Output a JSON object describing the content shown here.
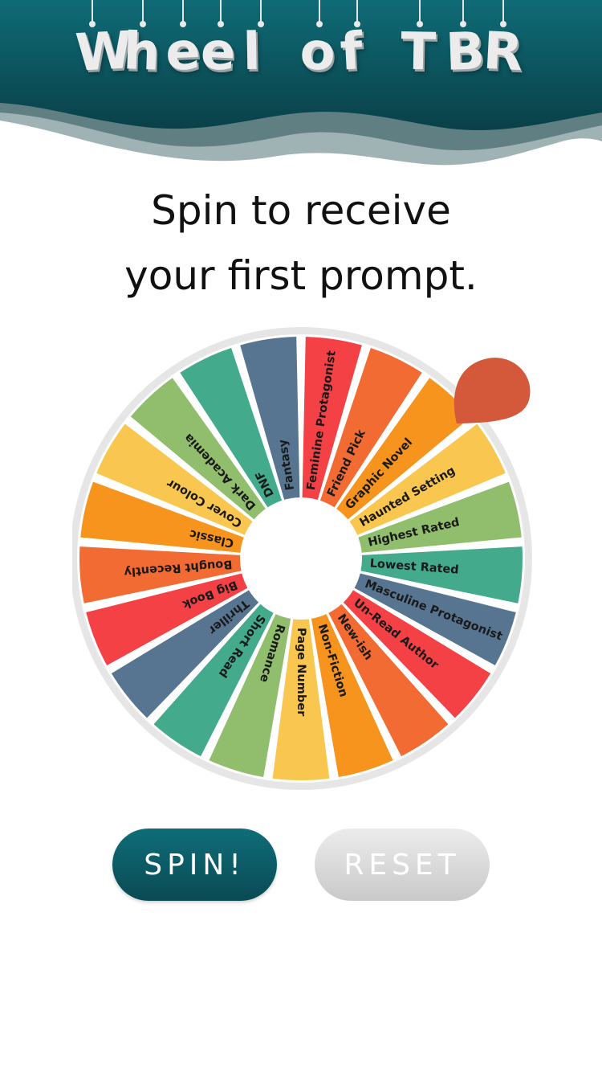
{
  "header": {
    "title": "Wheel of TBR",
    "colors": {
      "teal_top": "#0e6b76",
      "teal_bottom": "#0a4048",
      "wave_light": "#8ea3a6"
    }
  },
  "prompt": {
    "line1": "Spin to receive",
    "line2": "your first prompt."
  },
  "wheel": {
    "rim_color": "#e6e6e6",
    "pointer_color": "#d4583a",
    "segments": [
      {
        "label": "Feminine Protagonist",
        "color": "#f44146"
      },
      {
        "label": "Friend Pick",
        "color": "#f26b33"
      },
      {
        "label": "Graphic Novel",
        "color": "#f7941d"
      },
      {
        "label": "Haunted Setting",
        "color": "#f9c74f"
      },
      {
        "label": "Highest Rated",
        "color": "#90be6d"
      },
      {
        "label": "Lowest Rated",
        "color": "#43aa8b"
      },
      {
        "label": "Masculine Protagonist",
        "color": "#577590"
      },
      {
        "label": "Un-Read Author",
        "color": "#f44146"
      },
      {
        "label": "New-ish",
        "color": "#f26b33"
      },
      {
        "label": "Non-Fiction",
        "color": "#f7941d"
      },
      {
        "label": "Page Number",
        "color": "#f9c74f"
      },
      {
        "label": "Romance",
        "color": "#90be6d"
      },
      {
        "label": "Short Read",
        "color": "#43aa8b"
      },
      {
        "label": "Thriller",
        "color": "#577590"
      },
      {
        "label": "Big Book",
        "color": "#f44146"
      },
      {
        "label": "Bought Recently",
        "color": "#f26b33"
      },
      {
        "label": "Classic",
        "color": "#f7941d"
      },
      {
        "label": "Cover Colour",
        "color": "#f9c74f"
      },
      {
        "label": "Dark Academia",
        "color": "#90be6d"
      },
      {
        "label": "DNF",
        "color": "#43aa8b"
      },
      {
        "label": "Fantasy",
        "color": "#577590"
      }
    ]
  },
  "buttons": {
    "spin_label": "SPIN!",
    "reset_label": "RESET"
  }
}
